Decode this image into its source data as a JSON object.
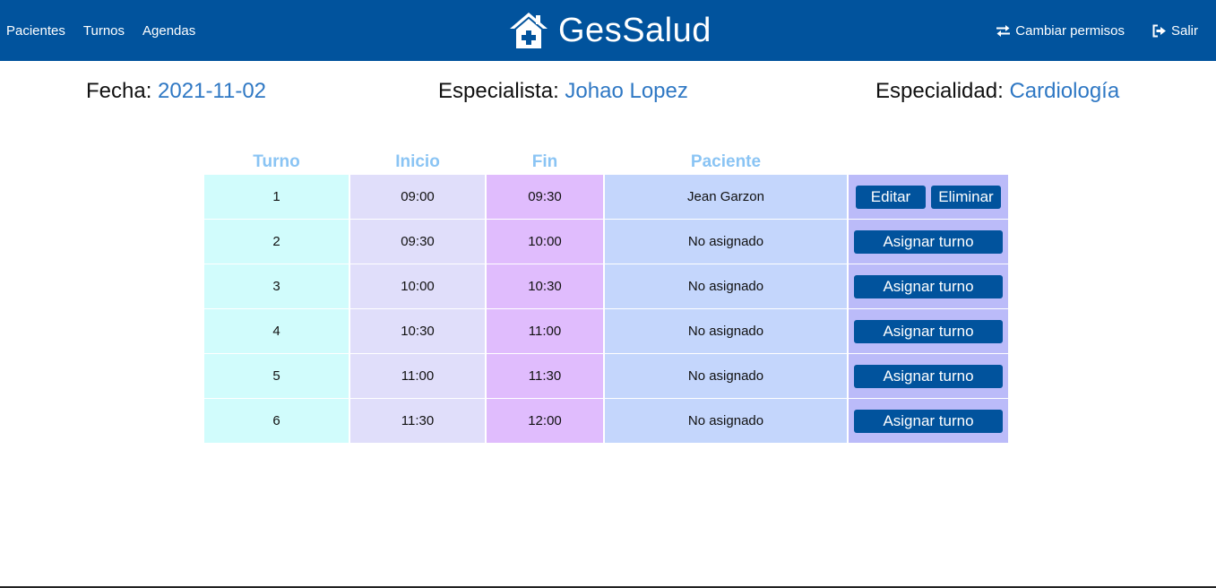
{
  "nav": {
    "links": [
      "Pacientes",
      "Turnos",
      "Agendas"
    ],
    "brand": "GesSalud",
    "brand_icon": "hospital-house-icon",
    "actions": [
      {
        "label": "Cambiar permisos",
        "icon": "exchange-icon"
      },
      {
        "label": "Salir",
        "icon": "sign-out-icon"
      }
    ]
  },
  "info": {
    "fecha_label": "Fecha:",
    "fecha_value": "2021-11-02",
    "especialista_label": "Especialista:",
    "especialista_value": "Johao Lopez",
    "especialidad_label": "Especialidad:",
    "especialidad_value": "Cardiología"
  },
  "table": {
    "headers": [
      "Turno",
      "Inicio",
      "Fin",
      "Paciente"
    ],
    "rows": [
      {
        "turno": "1",
        "inicio": "09:00",
        "fin": "09:30",
        "paciente": "Jean Garzon",
        "edit_label": "Editar",
        "delete_label": "Eliminar"
      },
      {
        "turno": "2",
        "inicio": "09:30",
        "fin": "10:00",
        "paciente": "No asignado",
        "assign_label": "Asignar turno"
      },
      {
        "turno": "3",
        "inicio": "10:00",
        "fin": "10:30",
        "paciente": "No asignado",
        "assign_label": "Asignar turno"
      },
      {
        "turno": "4",
        "inicio": "10:30",
        "fin": "11:00",
        "paciente": "No asignado",
        "assign_label": "Asignar turno"
      },
      {
        "turno": "5",
        "inicio": "11:00",
        "fin": "11:30",
        "paciente": "No asignado",
        "assign_label": "Asignar turno"
      },
      {
        "turno": "6",
        "inicio": "11:30",
        "fin": "12:00",
        "paciente": "No asignado",
        "assign_label": "Asignar turno"
      }
    ]
  },
  "colors": {
    "navbar": "#01539d",
    "accent_text": "#2f78c4",
    "header_text": "#8ac4f4",
    "col_turno": "#d1fcfc",
    "col_inicio": "#e0defa",
    "col_fin": "#e0bcfd",
    "col_paciente": "#c4d6fc",
    "col_acciones": "#bbbbf9"
  }
}
